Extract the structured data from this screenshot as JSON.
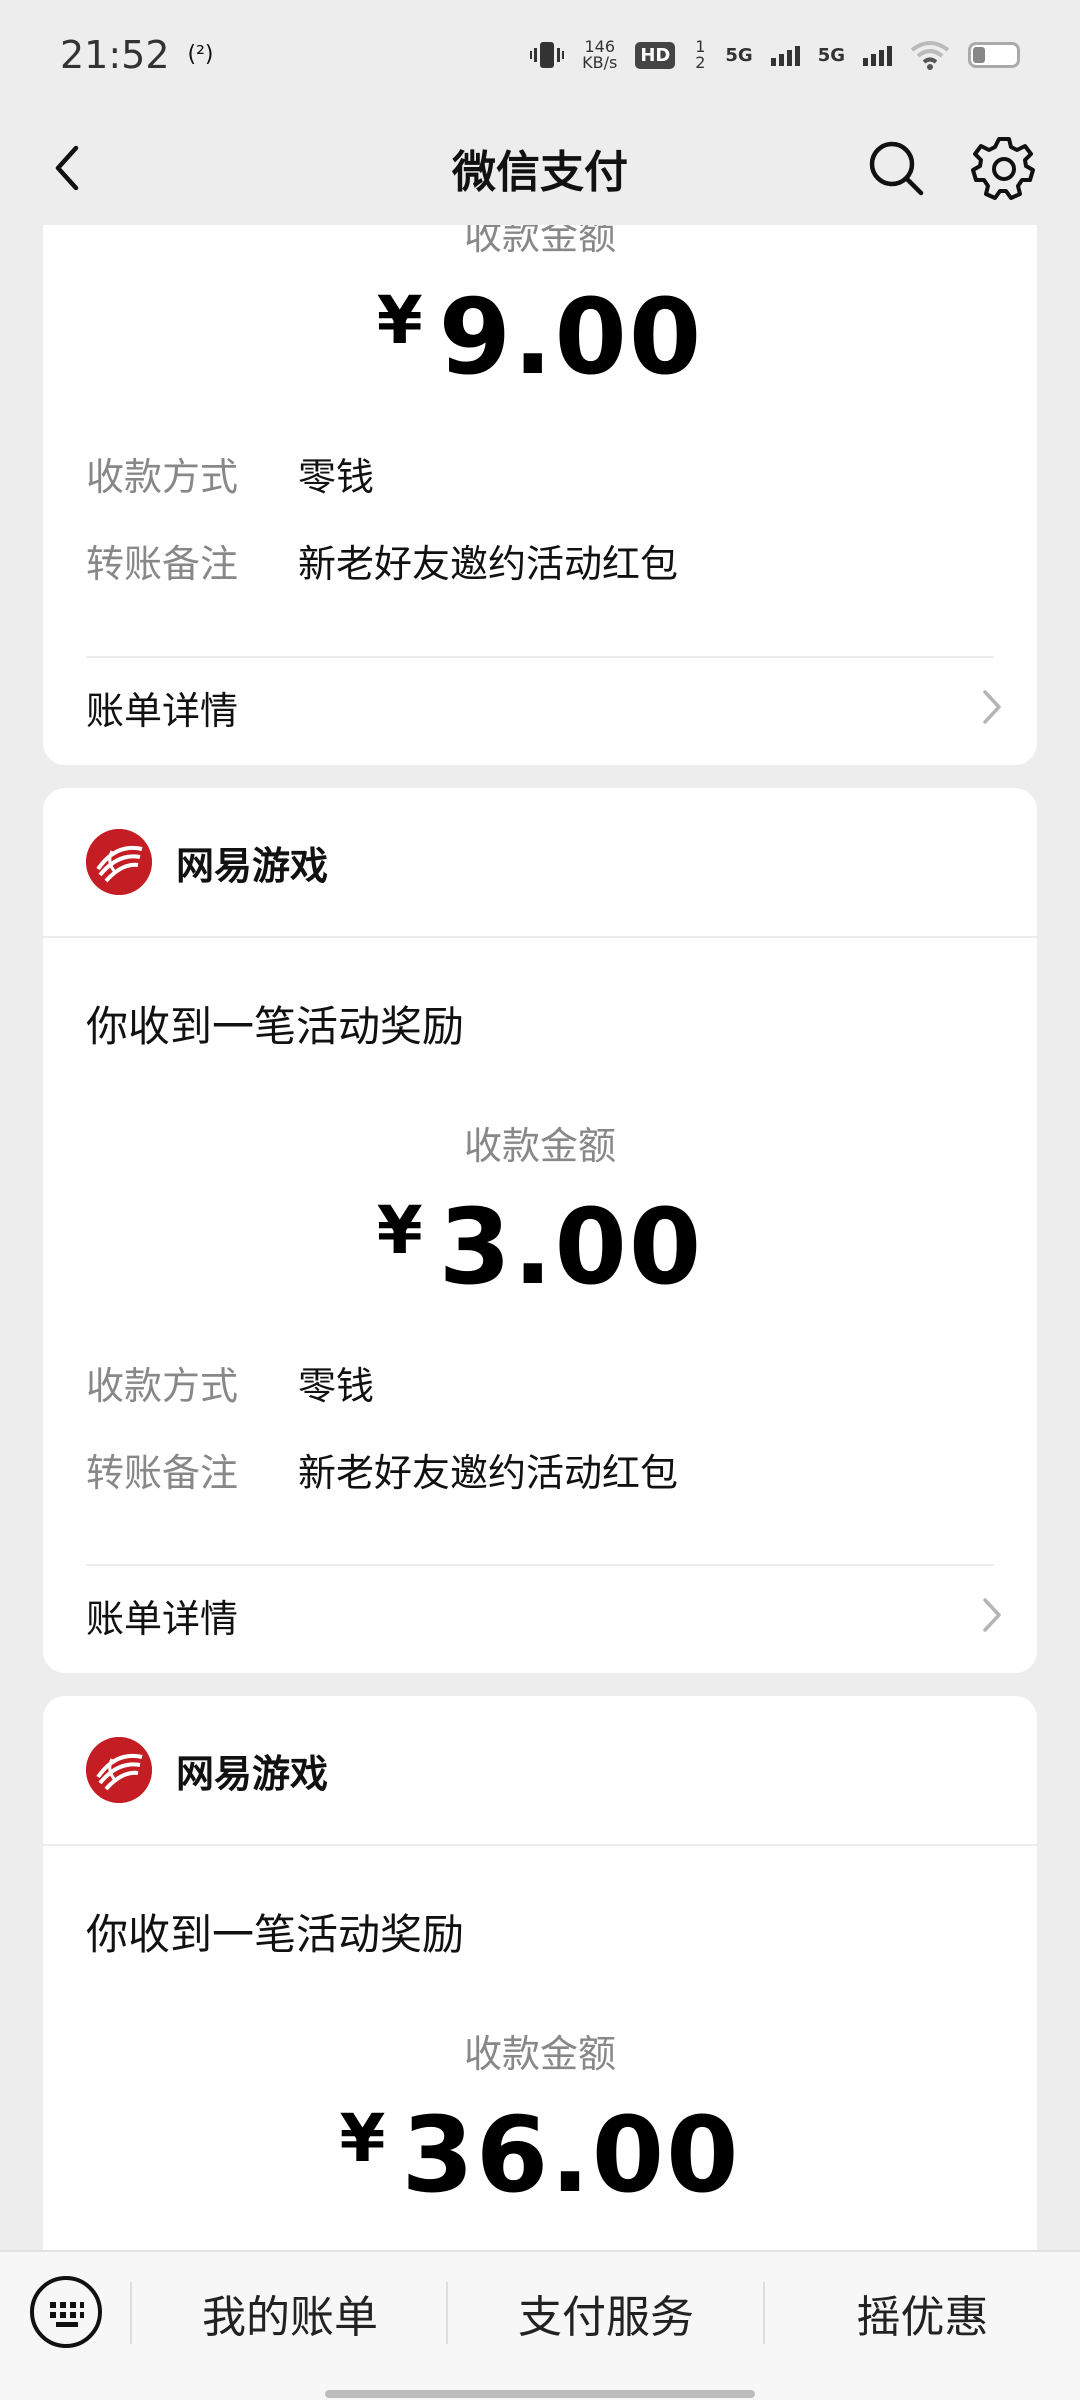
{
  "status_bar": {
    "time": "21:52",
    "nfc_text": "(²)",
    "speed_value": "146",
    "speed_unit": "KB/s",
    "hd_label": "HD",
    "hd_sub": "1 2",
    "net1": "5G",
    "net2": "5G"
  },
  "nav": {
    "title": "微信支付"
  },
  "cards": [
    {
      "amount_label": "收款金额",
      "currency": "¥",
      "amount": "9.00",
      "method_key": "收款方式",
      "method_value": "零钱",
      "note_key": "转账备注",
      "note_value": "新老好友邀约活动红包",
      "detail_label": "账单详情"
    },
    {
      "merchant": "网易游戏",
      "message": "你收到一笔活动奖励",
      "amount_label": "收款金额",
      "currency": "¥",
      "amount": "3.00",
      "method_key": "收款方式",
      "method_value": "零钱",
      "note_key": "转账备注",
      "note_value": "新老好友邀约活动红包",
      "detail_label": "账单详情"
    },
    {
      "merchant": "网易游戏",
      "message": "你收到一笔活动奖励",
      "amount_label": "收款金额",
      "currency": "¥",
      "amount": "36.00"
    }
  ],
  "bottom_bar": {
    "items": [
      "我的账单",
      "支付服务",
      "摇优惠"
    ]
  },
  "colors": {
    "background": "#ededed",
    "card": "#ffffff",
    "secondary_text": "#888888",
    "brand_red": "#c41e24"
  }
}
